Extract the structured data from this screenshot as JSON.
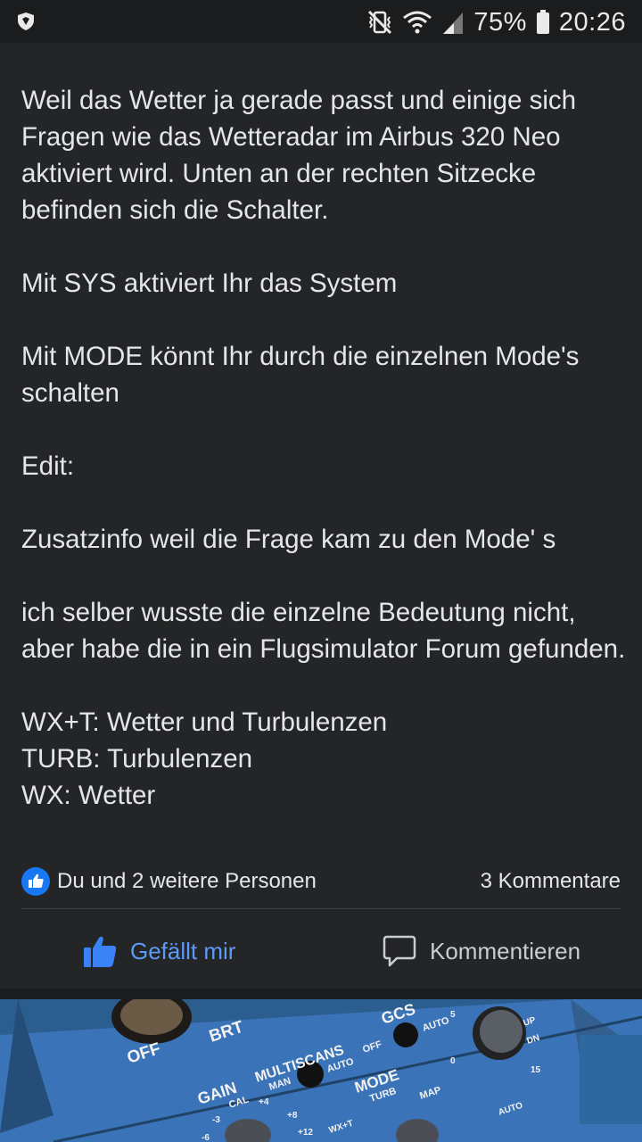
{
  "status_bar": {
    "battery_percent": "75%",
    "time": "20:26",
    "icons": [
      "shield-icon",
      "vibrate-mute-icon",
      "wifi-icon",
      "signal-icon",
      "battery-icon"
    ]
  },
  "post": {
    "paragraphs": [
      "Weil das Wetter ja gerade passt und einige sich Fragen wie das Wetteradar im Airbus 320 Neo aktiviert wird. Unten an der rechten Sitzecke befinden sich die Schalter.",
      "",
      "Mit SYS aktiviert Ihr das System",
      "",
      "Mit MODE könnt Ihr durch die einzelnen Mode's schalten",
      "",
      "Edit:",
      "",
      "Zusatzinfo weil die Frage kam zu den Mode' s",
      "",
      "ich selber wusste die einzelne Bedeutung nicht, aber habe die in ein Flugsimulator Forum gefunden.",
      "",
      "WX+T: Wetter und Turbulenzen",
      "TURB: Turbulenzen",
      "WX: Wetter"
    ],
    "reactions_text": "Du und 2 weitere Personen",
    "comments_count": "3 Kommentare",
    "like_label": "Gefällt mir",
    "comment_label": "Kommentieren",
    "like_color": "#5b9bf8",
    "reaction_badge_color": "#1877f2"
  },
  "photo": {
    "panel_labels": {
      "off": "OFF",
      "brt": "BRT",
      "gcs": "GCS",
      "auto": "AUTO",
      "multiscans": "MULTISCANS",
      "man": "MAN",
      "gain": "GAIN",
      "cal": "CAL",
      "mode": "MODE",
      "turb": "TURB",
      "map": "MAP",
      "wxt": "WX+T",
      "up": "UP",
      "dn": "DN",
      "t5": "5",
      "t0": "0",
      "t15": "15",
      "tn3": "-3",
      "tp4": "+4",
      "tp8": "+8",
      "tp12": "+12",
      "tn6": "-6"
    },
    "panel_color": "#3b73b8"
  }
}
